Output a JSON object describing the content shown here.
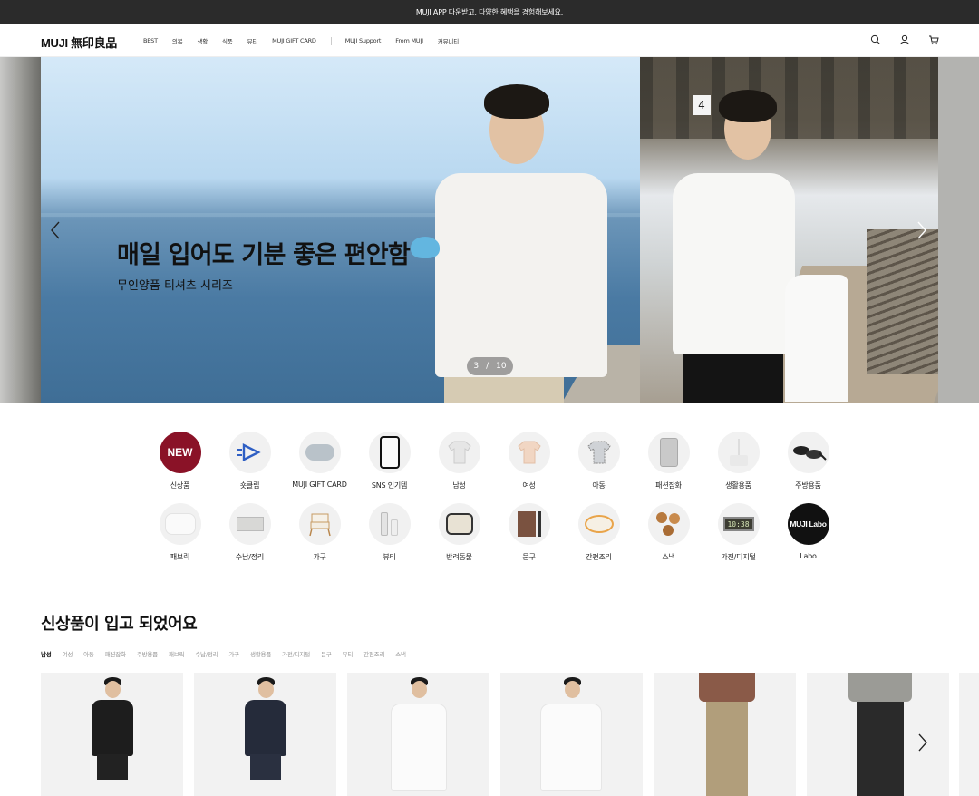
{
  "announcement": "MUJI APP 다운받고, 다양한 혜택을 경험해보세요.",
  "header": {
    "logo": "MUJI 無印良品",
    "nav": [
      "BEST",
      "의복",
      "생활",
      "식품",
      "뷰티",
      "MUJI GIFT CARD",
      "MUJI Support",
      "From MUJI",
      "커뮤니티"
    ],
    "icons": [
      "search-icon",
      "user-icon",
      "cart-icon"
    ]
  },
  "hero": {
    "title": "매일 입어도 기분 좋은 편안함",
    "subtitle": "무인양품 티셔츠 시리즈",
    "pager": {
      "current": "3",
      "sep": "/",
      "total": "10"
    },
    "platform_number": "4"
  },
  "categories": {
    "row1": [
      {
        "label": "신상품",
        "badge": "NEW"
      },
      {
        "label": "숏클립",
        "icon": "play-icon"
      },
      {
        "label": "MUJI GIFT CARD",
        "icon": "gift-card-icon"
      },
      {
        "label": "SNS 인기템",
        "icon": "phone-icon"
      },
      {
        "label": "남성",
        "icon": "tshirt-icon"
      },
      {
        "label": "여성",
        "icon": "tshirt-icon"
      },
      {
        "label": "아동",
        "icon": "tshirt-icon"
      },
      {
        "label": "패션잡화",
        "icon": "suitcase-icon"
      },
      {
        "label": "생활용품",
        "icon": "diffuser-icon"
      },
      {
        "label": "주방용품",
        "icon": "pan-icon"
      }
    ],
    "row2": [
      {
        "label": "패브릭",
        "icon": "pillow-icon"
      },
      {
        "label": "수납/정리",
        "icon": "box-icon"
      },
      {
        "label": "가구",
        "icon": "chair-icon"
      },
      {
        "label": "뷰티",
        "icon": "bottle-icon"
      },
      {
        "label": "반려동물",
        "icon": "pet-bag-icon"
      },
      {
        "label": "문구",
        "icon": "notebook-icon"
      },
      {
        "label": "간편조리",
        "icon": "food-icon"
      },
      {
        "label": "스낵",
        "icon": "cookie-icon"
      },
      {
        "label": "가전/디지털",
        "icon": "clock-icon",
        "display": "10:38"
      },
      {
        "label": "Labo",
        "badge": "MUJI Labo"
      }
    ]
  },
  "section": {
    "title": "신상품이 입고 되었어요",
    "tabs": [
      "남성",
      "여성",
      "아동",
      "패션잡화",
      "주방용품",
      "패브릭",
      "수납/정리",
      "가구",
      "생활용품",
      "가전/디지털",
      "문구",
      "뷰티",
      "간편조리",
      "스낵"
    ],
    "active_tab": "남성"
  },
  "colors": {
    "topbar": "#2b2b2b",
    "new_badge": "#8a1227",
    "labo_badge": "#111111"
  }
}
